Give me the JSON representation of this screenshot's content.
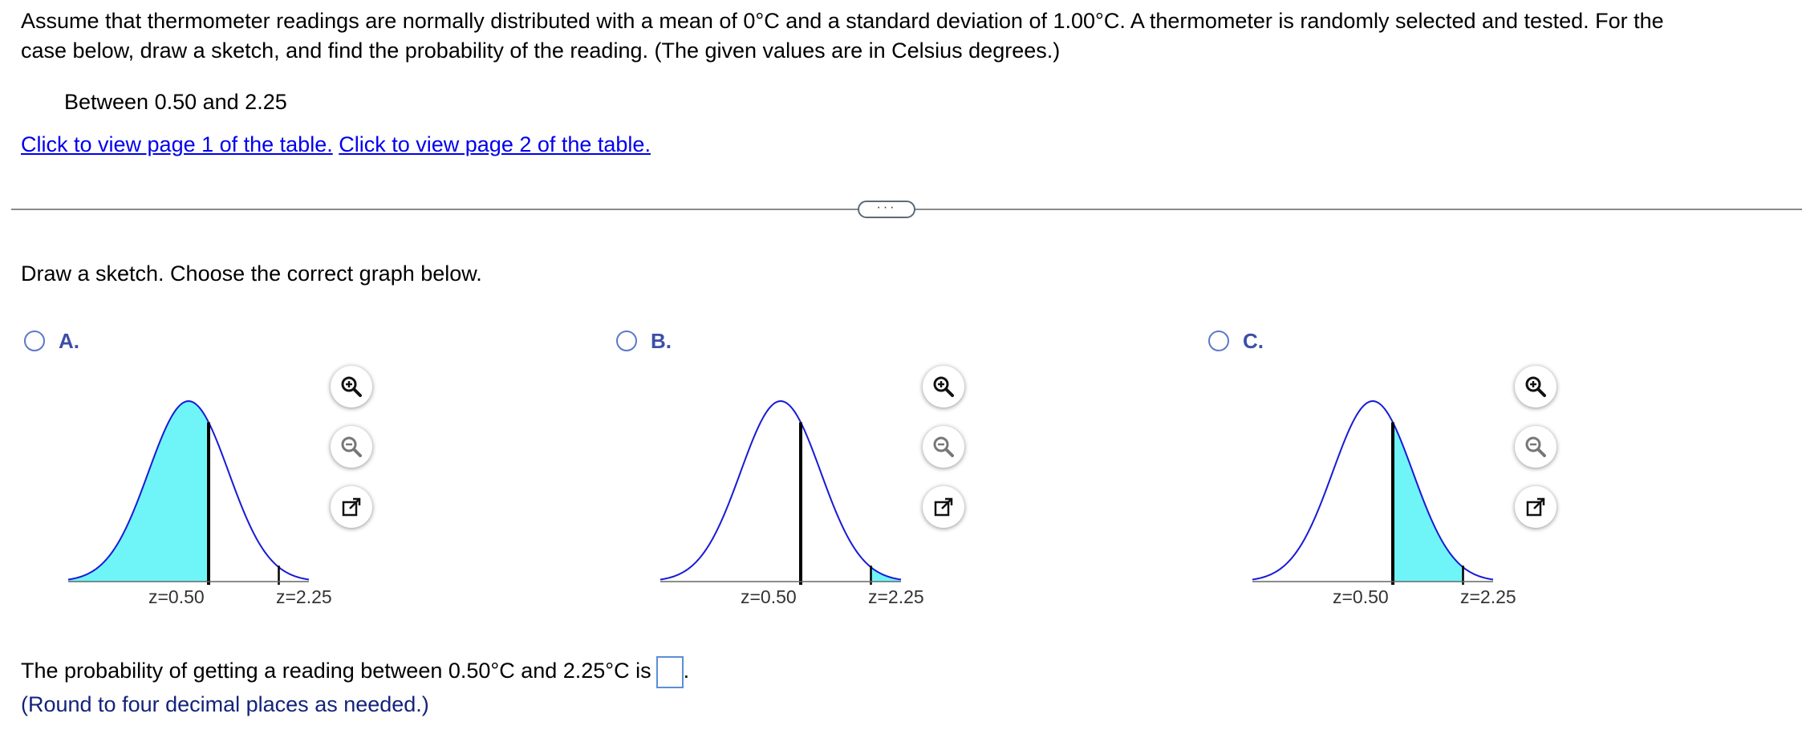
{
  "question": {
    "line1": "Assume that thermometer readings are normally distributed with a mean of 0°C and a standard deviation of 1.00°C. A thermometer is randomly selected and tested. For the",
    "line2": "case below, draw a sketch, and find the probability of the reading. (The given values are in Celsius degrees.)",
    "case": "Between 0.50 and 2.25"
  },
  "links": {
    "page1": "Click to view page 1 of the table.",
    "page2": "Click to view page 2 of the table."
  },
  "more_button": "···",
  "sketch_prompt": "Draw a sketch. Choose the correct graph below.",
  "options": [
    {
      "letter": "A.",
      "z1": "z=0.50",
      "z2": "z=2.25",
      "shade": "left_of_z1",
      "selected": false
    },
    {
      "letter": "B.",
      "z1": "z=0.50",
      "z2": "z=2.25",
      "shade": "right_of_z2",
      "selected": false
    },
    {
      "letter": "C.",
      "z1": "z=0.50",
      "z2": "z=2.25",
      "shade": "between",
      "selected": false
    }
  ],
  "colors": {
    "curve": "#1a1ad6",
    "shade": "#6ff5f8",
    "link": "#0000ee",
    "radio": "#5b79c7",
    "hint": "#13237b"
  },
  "tools": [
    "zoom-in-icon",
    "zoom-out-icon",
    "popout-icon"
  ],
  "answer": {
    "text": "The probability of getting a reading between 0.50°C and 2.25°C is",
    "value": "",
    "period": "."
  },
  "hint": "(Round to four decimal places as needed.)"
}
